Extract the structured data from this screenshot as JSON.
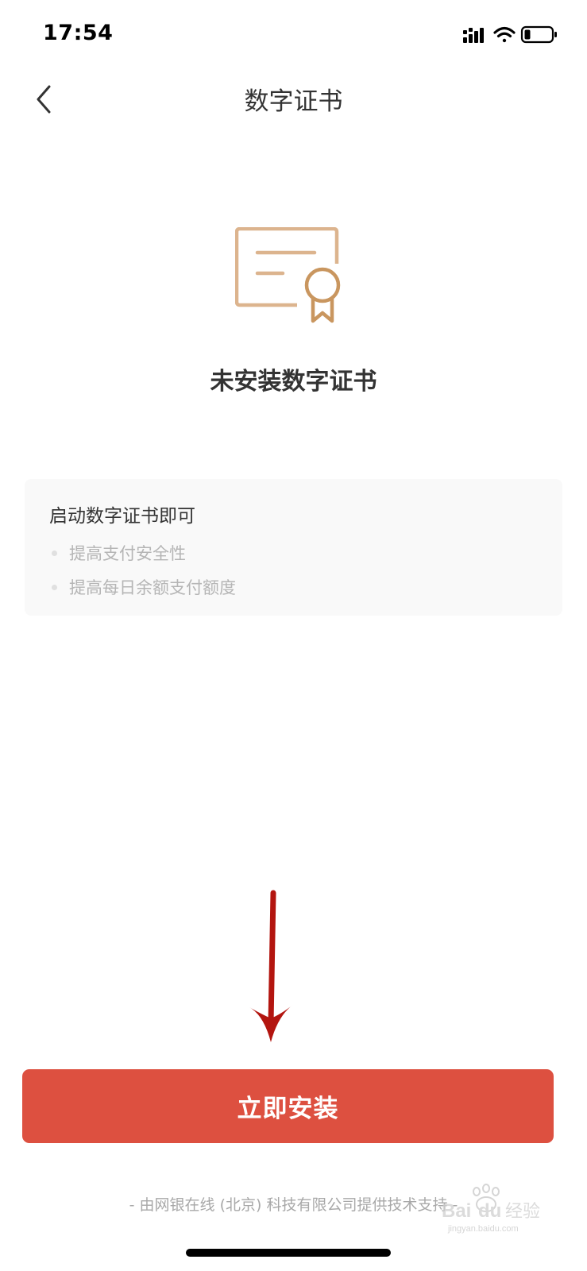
{
  "status_bar": {
    "time": "17:54"
  },
  "nav": {
    "title": "数字证书"
  },
  "cert_status": {
    "headline": "未安装数字证书"
  },
  "info_card": {
    "title": "启动数字证书即可",
    "items": [
      "提高支付安全性",
      "提高每日余额支付额度"
    ]
  },
  "install_button": {
    "label": "立即安装"
  },
  "footer": {
    "note": "- 由网银在线 (北京) 科技有限公司提供技术支持 -"
  },
  "watermark": {
    "brand": "Baidu 经验",
    "url": "jingyan.baidu.com"
  },
  "colors": {
    "accent": "#dd5040",
    "icon_gold": "#c9965f",
    "annotation_red": "#b3150f"
  },
  "icons": {
    "back": "chevron-left-icon",
    "certificate": "certificate-icon",
    "signal": "signal-icon",
    "wifi": "wifi-icon",
    "battery": "battery-icon"
  }
}
